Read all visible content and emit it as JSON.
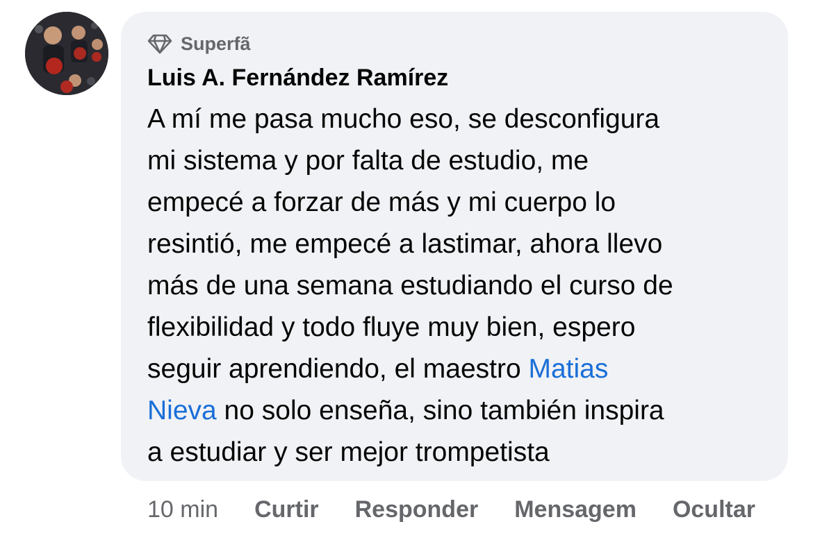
{
  "comment": {
    "badge": {
      "icon": "diamond-icon",
      "label": "Superfã"
    },
    "author": "Luis A. Fernández Ramírez",
    "lines": [
      "A mí me pasa mucho eso, se desconfigura",
      "mi sistema y por falta de estudio, me",
      "empecé a forzar de más y mi cuerpo lo",
      "resintió, me empecé a lastimar, ahora llevo",
      "más de una semana estudiando el curso de",
      "flexibilidad y todo fluye muy bien, espero"
    ],
    "line7_text": "seguir aprendiendo, el maestro ",
    "mention_part1": "Matias",
    "mention_part2": "Nieva",
    "line8_rest": " no solo enseña, sino también inspira",
    "line9": "a estudiar y ser mejor trompetista",
    "mention_color": "#1a6ed8"
  },
  "actions": {
    "time": "10 min",
    "like": "Curtir",
    "reply": "Responder",
    "message": "Mensagem",
    "hide": "Ocultar"
  }
}
